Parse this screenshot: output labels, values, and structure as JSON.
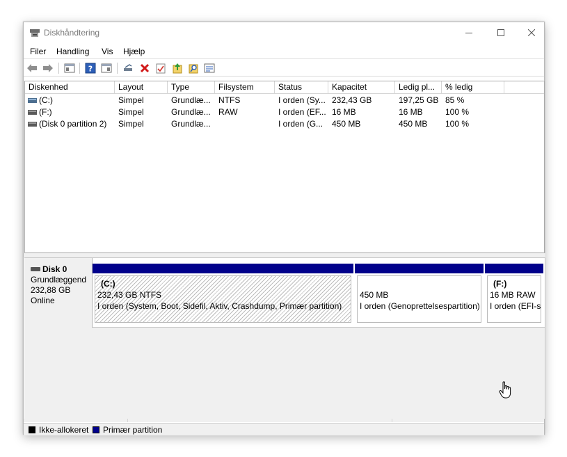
{
  "window": {
    "title": "Diskhåndtering"
  },
  "menu": [
    {
      "label": "Filer"
    },
    {
      "label": "Handling"
    },
    {
      "label": "Vis"
    },
    {
      "label": "Hjælp"
    }
  ],
  "toolbar": {
    "icons": [
      "back-arrow-icon",
      "forward-arrow-icon",
      "console-tree-icon",
      "help-icon",
      "action-pane-icon",
      "connect-disk-icon",
      "delete-icon",
      "properties-icon",
      "export-icon",
      "find-icon",
      "view-icon"
    ]
  },
  "volume_list": {
    "columns": [
      "Diskenhed",
      "Layout",
      "Type",
      "Filsystem",
      "Status",
      "Kapacitet",
      "Ledig pl...",
      "% ledig"
    ],
    "rows": [
      {
        "icon": "drive-icon",
        "volume": "(C:)",
        "layout": "Simpel",
        "type": "Grundlæ...",
        "fs": "NTFS",
        "status": "I orden (Sy...",
        "capacity": "232,43 GB",
        "free": "197,25 GB",
        "pct": "85 %"
      },
      {
        "icon": "drive-icon",
        "volume": "(F:)",
        "layout": "Simpel",
        "type": "Grundlæ...",
        "fs": "RAW",
        "status": "I orden (EF...",
        "capacity": "16 MB",
        "free": "16 MB",
        "pct": "100 %"
      },
      {
        "icon": "drive-icon",
        "volume": "(Disk 0 partition 2)",
        "layout": "Simpel",
        "type": "Grundlæ...",
        "fs": "",
        "status": "I orden (G...",
        "capacity": "450 MB",
        "free": "450 MB",
        "pct": "100 %"
      }
    ]
  },
  "disk0": {
    "name": "Disk 0",
    "type": "Grundlæggend",
    "size": "232,88 GB",
    "state": "Online",
    "partitions": [
      {
        "name": "(C:)",
        "line1": "232,43 GB NTFS",
        "line2": "I orden (System, Boot, Sidefil, Aktiv, Crashdump, Primær partition)"
      },
      {
        "name": "",
        "line1": "450 MB",
        "line2": "I orden (Genoprettelsespartition)"
      },
      {
        "name": "(F:)",
        "line1": "16 MB RAW",
        "line2": "I orden (EFI-s"
      }
    ]
  },
  "legend": {
    "items": [
      {
        "label": "Ikke-allokeret",
        "color": "#000000"
      },
      {
        "label": "Primær partition",
        "color": "#00008b"
      }
    ]
  }
}
